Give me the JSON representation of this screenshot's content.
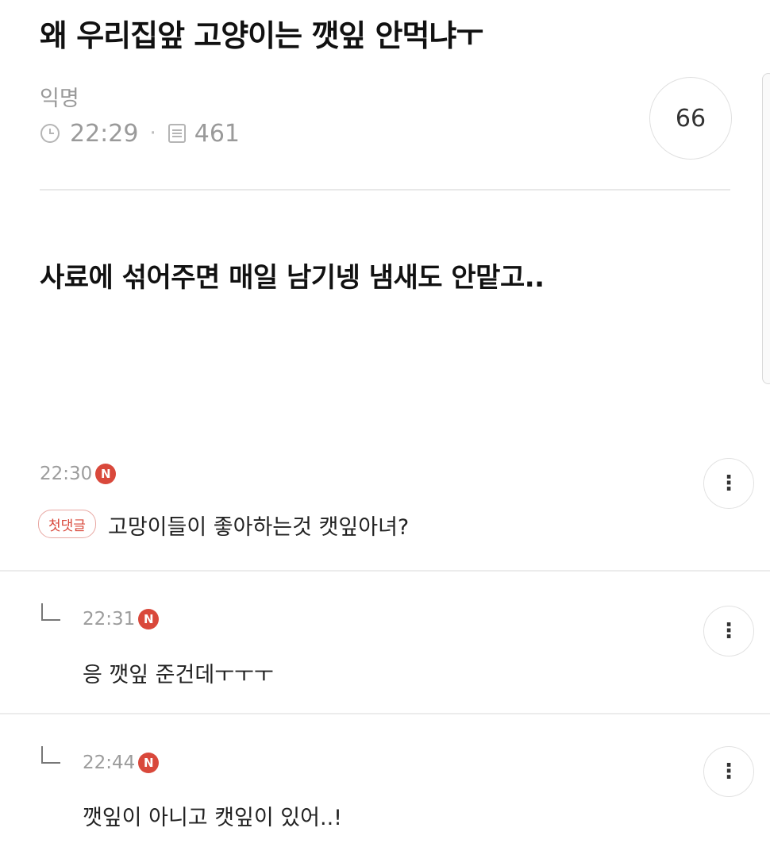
{
  "post": {
    "title": "왜 우리집앞 고양이는 깻잎 안먹냐ㅜ",
    "author": "익명",
    "time": "22:29",
    "separator": "·",
    "views": "461",
    "comment_count": "66",
    "body": "사료에 섞어주면 매일 남기넹 냄새도 안맡고.."
  },
  "icons": {
    "clock": "clock-icon",
    "views": "document-icon",
    "new_badge": "N",
    "more": "⋮",
    "reply": "reply-arrow-icon"
  },
  "comments": [
    {
      "time": "22:30",
      "badge_text": "N",
      "first_label": "첫댓글",
      "text": "고망이들이 좋아하는것 캣잎아녀?"
    },
    {
      "time": "22:31",
      "badge_text": "N",
      "text": "응 깻잎 준건데ㅜㅜㅜ"
    },
    {
      "time": "22:44",
      "badge_text": "N",
      "text": "깻잎이 아니고 캣잎이 있어..!"
    }
  ]
}
